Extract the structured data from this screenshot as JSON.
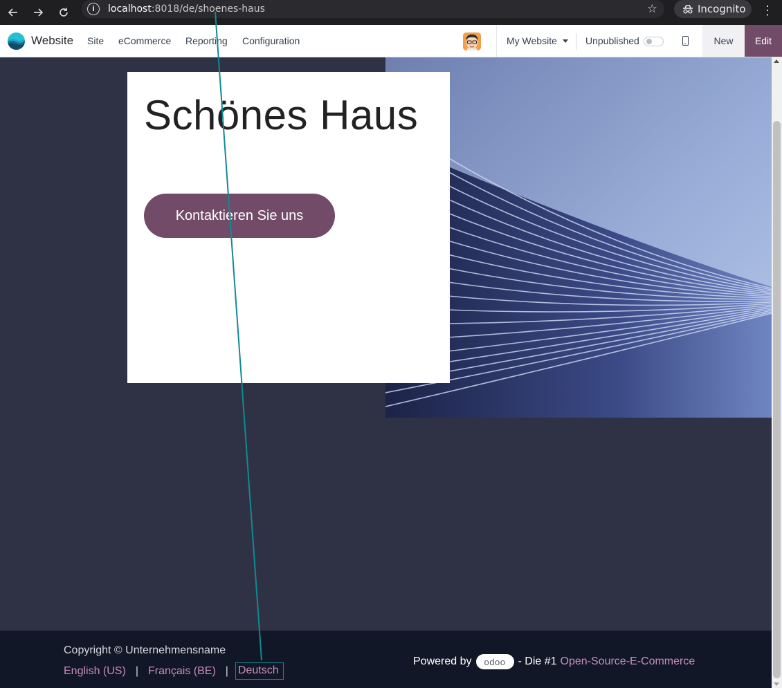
{
  "browser": {
    "url_host": "localhost",
    "url_path": ":8018/de/shoenes-haus",
    "incognito_label": "Incognito"
  },
  "odoo_nav": {
    "app_name": "Website",
    "menu": [
      "Site",
      "eCommerce",
      "Reporting",
      "Configuration"
    ],
    "website_selector": "My Website",
    "publish_status": "Unpublished",
    "new_label": "New",
    "edit_label": "Edit"
  },
  "hero": {
    "title": "Schönes Haus",
    "cta_label": "Kontaktieren Sie uns"
  },
  "footer": {
    "copyright": "Copyright © Unternehmensname",
    "languages": [
      "English (US)",
      "Français (BE)",
      "Deutsch"
    ],
    "active_language": "Deutsch",
    "powered_prefix": "Powered by",
    "odoo_logo_text": "odoo",
    "tagline": "- Die #1",
    "tagline_link": "Open-Source-E-Commerce"
  },
  "colors": {
    "brand": "#714b67",
    "page_bg": "#2f3244",
    "footer_bg": "#111726",
    "link": "#c98fbf",
    "highlight": "#118a93"
  },
  "icons": [
    "back-arrow-icon",
    "forward-arrow-icon",
    "reload-icon",
    "site-info-icon",
    "bookmark-star-icon",
    "incognito-icon",
    "kebab-menu-icon",
    "odoo-logo-icon",
    "mobile-preview-icon",
    "caret-down-icon"
  ]
}
